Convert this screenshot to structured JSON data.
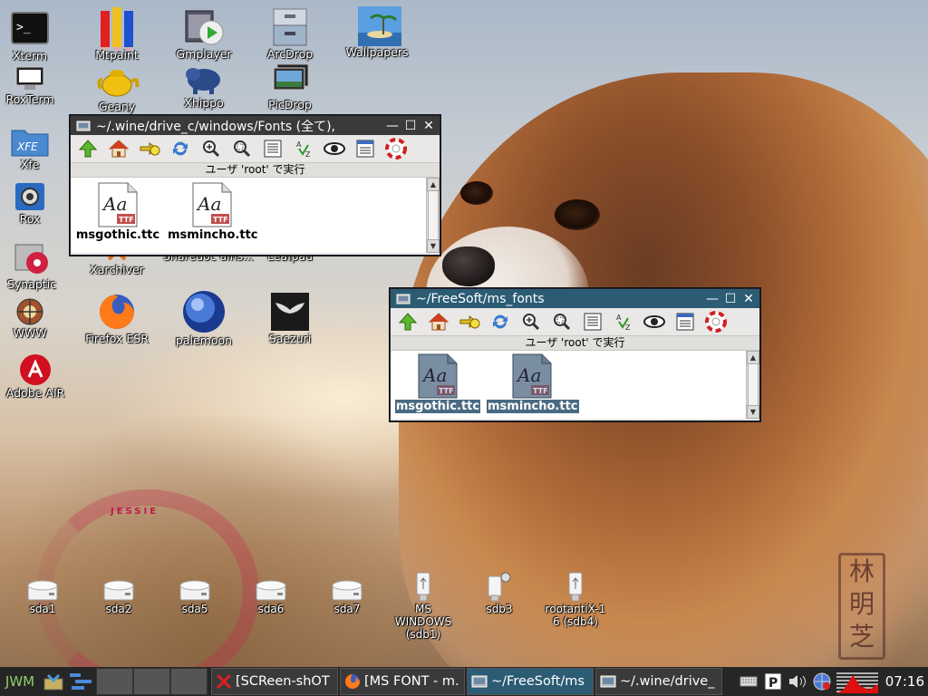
{
  "desktop": {
    "wallpaper_signature": "JESSIE",
    "icons": [
      {
        "label": "Xterm",
        "icon": "terminal-icon"
      },
      {
        "label": "Mtpaint",
        "icon": "pencils-icon"
      },
      {
        "label": "Gmplayer",
        "icon": "media-player-icon"
      },
      {
        "label": "ArcDrop",
        "icon": "archive-icon"
      },
      {
        "label": "Wallpapers",
        "icon": "landscape-icon"
      },
      {
        "label": "RoxTerm",
        "icon": "monitor-icon"
      },
      {
        "label": "Geany",
        "icon": "teapot-icon"
      },
      {
        "label": "Xhippo",
        "icon": "hippo-icon"
      },
      {
        "label": "PicDrop",
        "icon": "picture-stack-icon"
      },
      {
        "label": "Xfe",
        "icon": "xfe-folder-icon"
      },
      {
        "label": "Rox",
        "icon": "gear-box-icon"
      },
      {
        "label": "Synaptic",
        "icon": "package-icon"
      },
      {
        "label": "Xarchiver",
        "icon": "xarchiver-icon"
      },
      {
        "label": "WWW",
        "icon": "globe-browser-icon"
      },
      {
        "label": "Firefox ESR",
        "icon": "firefox-icon"
      },
      {
        "label": "palemoon",
        "icon": "palemoon-icon"
      },
      {
        "label": "Saezuri",
        "icon": "whale-tail-icon"
      },
      {
        "label": "Adobe AIR",
        "icon": "adobe-air-icon"
      }
    ],
    "hidden_labels": [
      "Sharedoc ains...",
      "Leafpad"
    ],
    "drives": [
      {
        "label": "sda1",
        "type": "hdd"
      },
      {
        "label": "sda2",
        "type": "hdd"
      },
      {
        "label": "sda5",
        "type": "hdd"
      },
      {
        "label": "sda6",
        "type": "hdd"
      },
      {
        "label": "sda7",
        "type": "hdd"
      },
      {
        "label": "MS\nWINDOWS\n(sdb1)",
        "type": "usb"
      },
      {
        "label": "sdb3",
        "type": "usb"
      },
      {
        "label": "rootantiX-1\n6 (sdb4)",
        "type": "usb"
      }
    ]
  },
  "window_fonts": {
    "title": "~/.wine/drive_c/windows/Fonts (全て),",
    "status": "ユーザ 'root' で実行",
    "files": [
      {
        "name": "msgothic.ttc",
        "badge": "TTF",
        "glyph": "Aa"
      },
      {
        "name": "msmincho.ttc",
        "badge": "TTF",
        "glyph": "Aa"
      }
    ]
  },
  "window_msfonts": {
    "title": "~/FreeSoft/ms_fonts",
    "status": "ユーザ 'root' で実行",
    "files": [
      {
        "name": "msgothic.ttc",
        "badge": "TTF",
        "glyph": "Aa"
      },
      {
        "name": "msmincho.ttc",
        "badge": "TTF",
        "glyph": "Aa"
      }
    ]
  },
  "toolbar_tools": [
    "up-icon",
    "home-icon",
    "bookmark-go-icon",
    "refresh-icon",
    "zoom-in-icon",
    "zoom-fit-icon",
    "list-view-icon",
    "sort-icon",
    "show-hidden-icon",
    "details-icon",
    "help-icon"
  ],
  "taskbar": {
    "menu_label": "JWM",
    "tasks": [
      {
        "label": "[SCReen-shOT",
        "icon": "screenshot-icon",
        "active": false
      },
      {
        "label": "[MS FONT - m.",
        "icon": "firefox-icon",
        "active": false
      },
      {
        "label": "~/FreeSoft/ms",
        "icon": "filer-icon",
        "active": true
      },
      {
        "label": "~/.wine/drive_",
        "icon": "filer-icon",
        "active": false
      }
    ],
    "clock": "07:16"
  }
}
